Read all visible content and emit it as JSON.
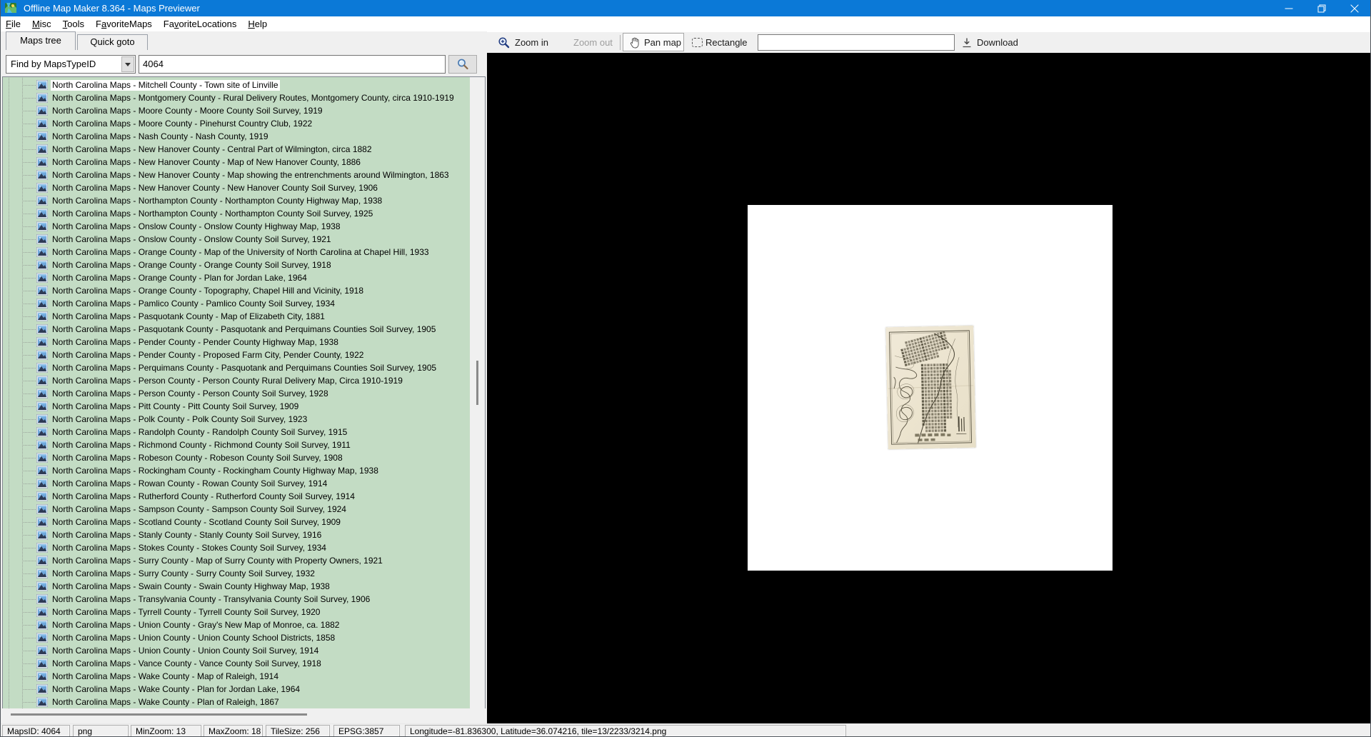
{
  "window": {
    "title": "Offline Map Maker 8.364 - Maps Previewer"
  },
  "menu": {
    "items": [
      {
        "label": "File",
        "accel_index": 0
      },
      {
        "label": "Misc",
        "accel_index": 0
      },
      {
        "label": "Tools",
        "accel_index": 0
      },
      {
        "label": "FavoriteMaps",
        "accel_index": 1
      },
      {
        "label": "FavoriteLocations",
        "accel_index": 2
      },
      {
        "label": "Help",
        "accel_index": 0
      }
    ]
  },
  "tabs": {
    "maps_tree": "Maps tree",
    "quick_goto": "Quick goto"
  },
  "search": {
    "dropdown_value": "Find by MapsTypeID",
    "query": "4064"
  },
  "tree": {
    "selected_index": 0,
    "items": [
      "North Carolina Maps - Mitchell County - Town site of Linville",
      "North Carolina Maps - Montgomery County - Rural Delivery Routes, Montgomery County, circa 1910-1919",
      "North Carolina Maps - Moore County - Moore County Soil Survey, 1919",
      "North Carolina Maps - Moore County - Pinehurst Country Club, 1922",
      "North Carolina Maps - Nash County - Nash County, 1919",
      "North Carolina Maps - New Hanover County - Central Part of Wilmington, circa 1882",
      "North Carolina Maps - New Hanover County - Map of New Hanover County, 1886",
      "North Carolina Maps - New Hanover County - Map showing the entrenchments around Wilmington, 1863",
      "North Carolina Maps - New Hanover County - New Hanover County Soil Survey, 1906",
      "North Carolina Maps - Northampton County - Northampton County Highway Map, 1938",
      "North Carolina Maps - Northampton County - Northampton County Soil Survey, 1925",
      "North Carolina Maps - Onslow County - Onslow County Highway Map, 1938",
      "North Carolina Maps - Onslow County - Onslow County Soil Survey, 1921",
      "North Carolina Maps - Orange County - Map of the University of North Carolina at Chapel Hill, 1933",
      "North Carolina Maps - Orange County - Orange County Soil Survey, 1918",
      "North Carolina Maps - Orange County - Plan for Jordan Lake, 1964",
      "North Carolina Maps - Orange County - Topography, Chapel Hill and Vicinity, 1918",
      "North Carolina Maps - Pamlico County - Pamlico County Soil Survey, 1934",
      "North Carolina Maps - Pasquotank County - Map of Elizabeth City, 1881",
      "North Carolina Maps - Pasquotank County - Pasquotank and Perquimans Counties Soil Survey, 1905",
      "North Carolina Maps - Pender County - Pender County Highway Map, 1938",
      "North Carolina Maps - Pender County - Proposed Farm City, Pender County, 1922",
      "North Carolina Maps - Perquimans County - Pasquotank and Perquimans Counties Soil Survey, 1905",
      "North Carolina Maps - Person County - Person County Rural Delivery Map, Circa 1910-1919",
      "North Carolina Maps - Person County - Person County Soil Survey, 1928",
      "North Carolina Maps - Pitt County - Pitt County Soil Survey, 1909",
      "North Carolina Maps - Polk County - Polk County Soil Survey, 1923",
      "North Carolina Maps - Randolph County - Randolph County Soil Survey, 1915",
      "North Carolina Maps - Richmond County - Richmond County Soil Survey, 1911",
      "North Carolina Maps - Robeson County - Robeson County Soil Survey, 1908",
      "North Carolina Maps - Rockingham County - Rockingham County Highway Map, 1938",
      "North Carolina Maps - Rowan County - Rowan County Soil Survey, 1914",
      "North Carolina Maps - Rutherford County - Rutherford County Soil Survey, 1914",
      "North Carolina Maps - Sampson County - Sampson County Soil Survey, 1924",
      "North Carolina Maps - Scotland County - Scotland County Soil Survey, 1909",
      "North Carolina Maps - Stanly County - Stanly County Soil Survey, 1916",
      "North Carolina Maps - Stokes County - Stokes County Soil Survey, 1934",
      "North Carolina Maps - Surry County - Map of Surry County with Property Owners, 1921",
      "North Carolina Maps - Surry County - Surry County Soil Survey, 1932",
      "North Carolina Maps - Swain County - Swain County Highway Map, 1938",
      "North Carolina Maps - Transylvania County - Transylvania County Soil Survey, 1906",
      "North Carolina Maps - Tyrrell County - Tyrrell County Soil Survey, 1920",
      "North Carolina Maps - Union County - Gray's New Map of Monroe, ca. 1882",
      "North Carolina Maps - Union County - Union County School Districts, 1858",
      "North Carolina Maps - Union County - Union County Soil Survey, 1914",
      "North Carolina Maps - Vance County - Vance County Soil Survey, 1918",
      "North Carolina Maps - Wake County - Map of Raleigh, 1914",
      "North Carolina Maps - Wake County - Plan for Jordan Lake, 1964",
      "North Carolina Maps - Wake County - Plan of Raleigh, 1867"
    ]
  },
  "toolbar": {
    "zoom_in": "Zoom in",
    "zoom_out": "Zoom out",
    "pan_map": "Pan map",
    "rectangle": "Rectangle",
    "input_value": "",
    "download": "Download"
  },
  "statusbar": {
    "panels": [
      "MapsID: 4064",
      "png",
      "MinZoom: 13",
      "MaxZoom: 18",
      "TileSize: 256",
      "EPSG:3857",
      "Longitude=-81.836300, Latitude=36.074216, tile=13/2233/3214.png"
    ]
  },
  "colors": {
    "titlebar_blue": "#0b79d7",
    "tree_background": "#c3dcc4",
    "map_paper": "#ece4d0"
  }
}
